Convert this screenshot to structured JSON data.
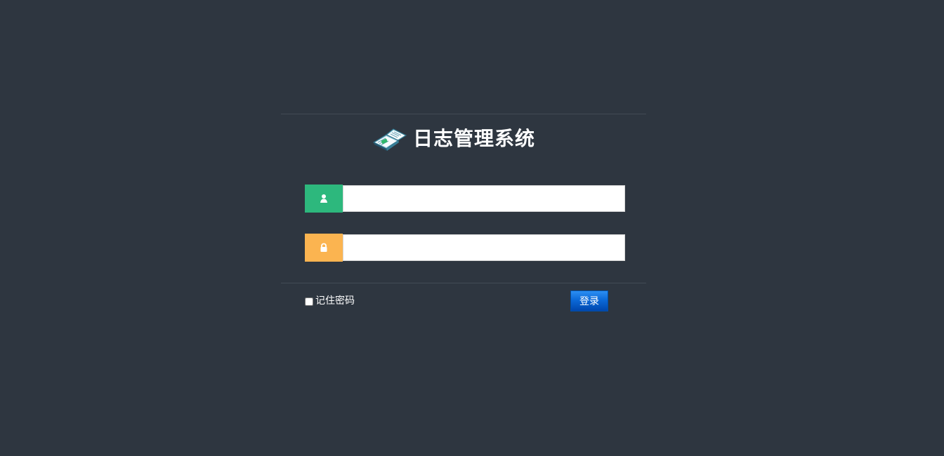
{
  "page": {
    "background_color": "#2e3640"
  },
  "login": {
    "title": "日志管理系统",
    "username": {
      "value": "",
      "placeholder": ""
    },
    "password": {
      "value": "",
      "placeholder": ""
    },
    "remember_label": "记住密码",
    "remember_checked": false,
    "submit_label": "登录"
  },
  "icons": {
    "logo": "book-icon",
    "username": "user-icon",
    "password": "lock-icon",
    "remember": "checkbox-icon"
  },
  "colors": {
    "username_accent": "#2db87d",
    "password_accent": "#fbb450",
    "button": "#0b69d8",
    "text": "#ffffff"
  }
}
